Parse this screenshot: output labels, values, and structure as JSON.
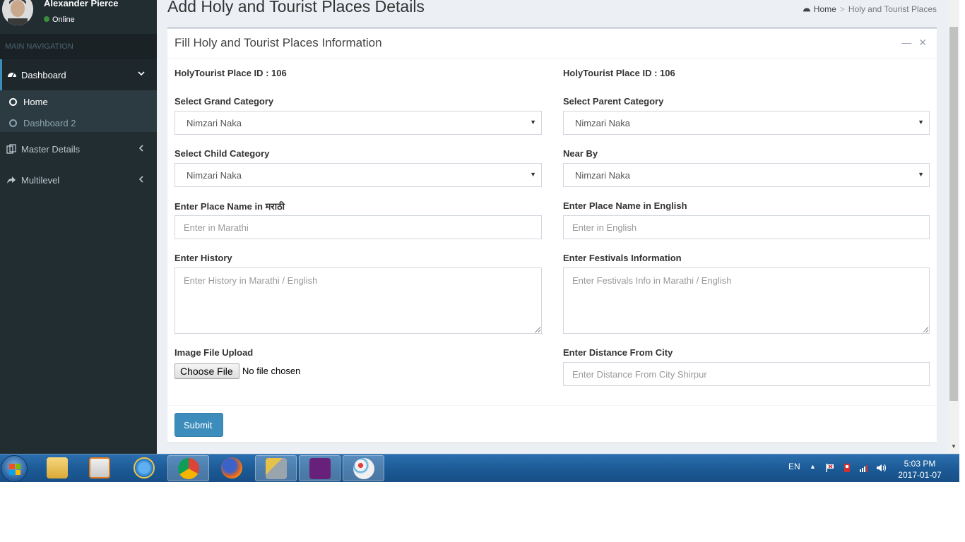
{
  "user": {
    "name": "Alexander Pierce",
    "status": "Online"
  },
  "sidebar": {
    "header": "MAIN NAVIGATION",
    "items": [
      {
        "label": "Dashboard",
        "icon": "dashboard-icon"
      },
      {
        "label": "Master Details",
        "icon": "copy-icon"
      },
      {
        "label": "Multilevel",
        "icon": "share-icon"
      }
    ],
    "subitems": [
      {
        "label": "Home"
      },
      {
        "label": "Dashboard 2"
      }
    ]
  },
  "page": {
    "title": "Add Holy and Tourist Places Details"
  },
  "breadcrumb": {
    "home": "Home",
    "current": "Holy and Tourist Places"
  },
  "box": {
    "title": "Fill Holy and Tourist Places Information"
  },
  "form": {
    "id_left": "HolyTourist Place ID : 106",
    "id_right": "HolyTourist Place ID : 106",
    "grand_category": {
      "label": "Select Grand Category",
      "value": "Nimzari Naka"
    },
    "parent_category": {
      "label": "Select Parent Category",
      "value": "Nimzari Naka"
    },
    "child_category": {
      "label": "Select Child Category",
      "value": "Nimzari Naka"
    },
    "near_by": {
      "label": "Near By",
      "value": "Nimzari Naka"
    },
    "place_marathi": {
      "label": "Enter Place Name in मराठी",
      "placeholder": "Enter in Marathi"
    },
    "place_english": {
      "label": "Enter Place Name in English",
      "placeholder": "Enter in English"
    },
    "history": {
      "label": "Enter History",
      "placeholder": "Enter History in Marathi / English"
    },
    "festivals": {
      "label": "Enter Festivals Information",
      "placeholder": "Enter Festivals Info in Marathi / English"
    },
    "image": {
      "label": "Image File Upload",
      "button": "Choose File",
      "status": "No file chosen"
    },
    "distance": {
      "label": "Enter Distance From City",
      "placeholder": "Enter Distance From City Shirpur"
    },
    "submit": "Submit"
  },
  "taskbar": {
    "language": "EN",
    "time": "5:03 PM",
    "date": "2017-01-07",
    "apps": [
      "file-explorer-icon",
      "media-player-icon",
      "internet-explorer-icon",
      "chrome-icon",
      "firefox-icon",
      "sql-tools-icon",
      "visual-studio-icon",
      "paint-icon"
    ]
  },
  "colors": {
    "sidebar": "#222d32",
    "content": "#ecf0f5",
    "primary": "#3c8dbc",
    "taskbar": "#1c5b97"
  }
}
